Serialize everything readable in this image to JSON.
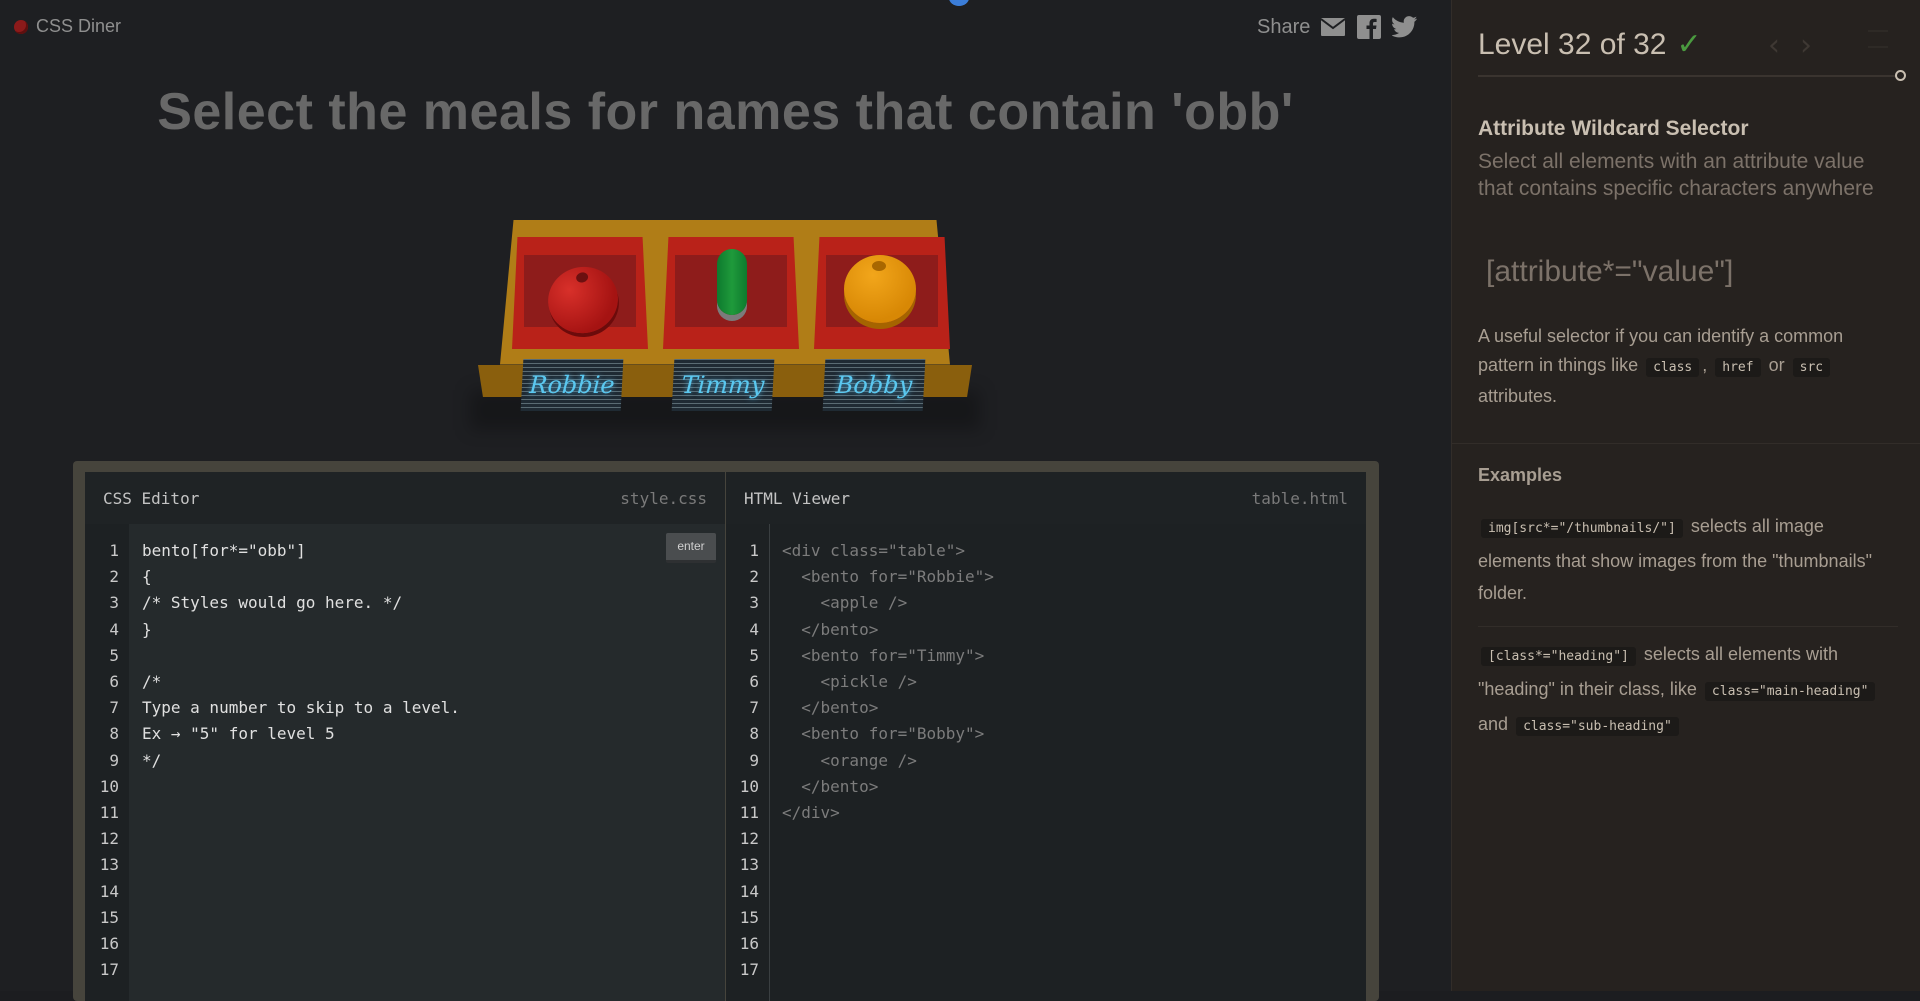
{
  "header": {
    "brand": "CSS Diner",
    "share_label": "Share"
  },
  "icons": {
    "brand": "plate-icon",
    "email": "email-icon",
    "facebook": "facebook-icon",
    "twitter": "twitter-icon"
  },
  "order": "Select the meals for names that contain 'obb'",
  "table": {
    "bentos": [
      {
        "name": "Robbie",
        "food": "apple"
      },
      {
        "name": "Timmy",
        "food": "pickle"
      },
      {
        "name": "Bobby",
        "food": "orange"
      }
    ]
  },
  "css_editor": {
    "title": "CSS Editor",
    "file": "style.css",
    "enter_label": "enter",
    "line_numbers": [
      "1",
      "2",
      "3",
      "4",
      "5",
      "6",
      "7",
      "8",
      "9",
      "10",
      "11",
      "12",
      "13",
      "14",
      "15",
      "16",
      "17"
    ],
    "lines": [
      "bento[for*=\"obb\"]",
      "{",
      "/* Styles would go here. */",
      "}",
      "",
      "/*",
      "Type a number to skip to a level.",
      "Ex → \"5\" for level 5",
      "*/"
    ]
  },
  "html_viewer": {
    "title": "HTML Viewer",
    "file": "table.html",
    "line_numbers": [
      "1",
      "2",
      "3",
      "4",
      "5",
      "6",
      "7",
      "8",
      "9",
      "10",
      "11",
      "12",
      "13",
      "14",
      "15",
      "16",
      "17"
    ],
    "lines": [
      "<div class=\"table\">",
      "  <bento for=\"Robbie\">",
      "    <apple />",
      "  </bento>",
      "  <bento for=\"Timmy\">",
      "    <pickle />",
      "  </bento>",
      "  <bento for=\"Bobby\">",
      "    <orange />",
      "  </bento>",
      "</div>"
    ]
  },
  "sidebar": {
    "level": "Level 32 of 32",
    "level_complete_icon": "checkmark-icon",
    "prev_label": "‹",
    "next_label": "›",
    "selector_name": "Attribute Wildcard Selector",
    "selector_title": "Select all elements with an attribute value that contains specific characters anywhere",
    "syntax": "[attribute*=\"value\"]",
    "hint": {
      "before": "A useful selector if you can identify a common pattern in things like",
      "chip1": "class",
      "sep1": ",",
      "chip2": "href",
      "sep2": "or",
      "chip3": "src",
      "after": "attributes."
    },
    "examples_heading": "Examples",
    "example1": {
      "code": "img[src*=\"/thumbnails/\"]",
      "text": "selects all image elements that show images from the \"thumbnails\" folder."
    },
    "example2": {
      "code": "[class*=\"heading\"]",
      "text1": "selects all elements with \"heading\" in their class, like",
      "code2": "class=\"main-heading\"",
      "and": "and",
      "code3": "class=\"sub-heading\""
    }
  }
}
